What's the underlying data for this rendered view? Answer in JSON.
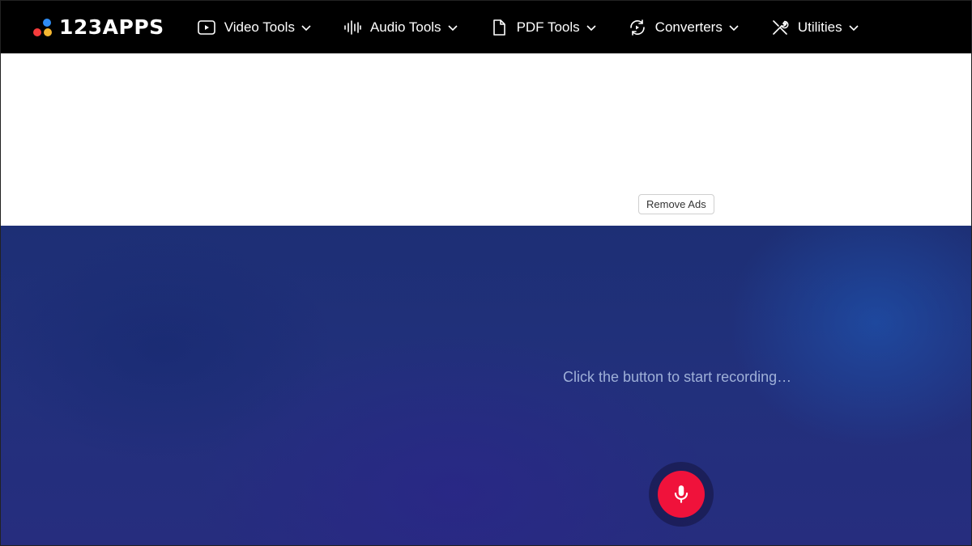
{
  "brand": {
    "name": "123APPS",
    "dot_colors": [
      "#2f8df5",
      "#f53b3b",
      "#f5b731"
    ]
  },
  "nav": {
    "items": [
      {
        "label": "Video Tools",
        "icon": "play-icon"
      },
      {
        "label": "Audio Tools",
        "icon": "waveform-icon"
      },
      {
        "label": "PDF Tools",
        "icon": "document-icon"
      },
      {
        "label": "Converters",
        "icon": "convert-icon"
      },
      {
        "label": "Utilities",
        "icon": "tools-icon"
      }
    ]
  },
  "ad": {
    "remove_label": "Remove Ads"
  },
  "recorder": {
    "status_text": "Click the button to start recording…",
    "record_icon": "microphone-icon",
    "record_color": "#f0123b"
  }
}
